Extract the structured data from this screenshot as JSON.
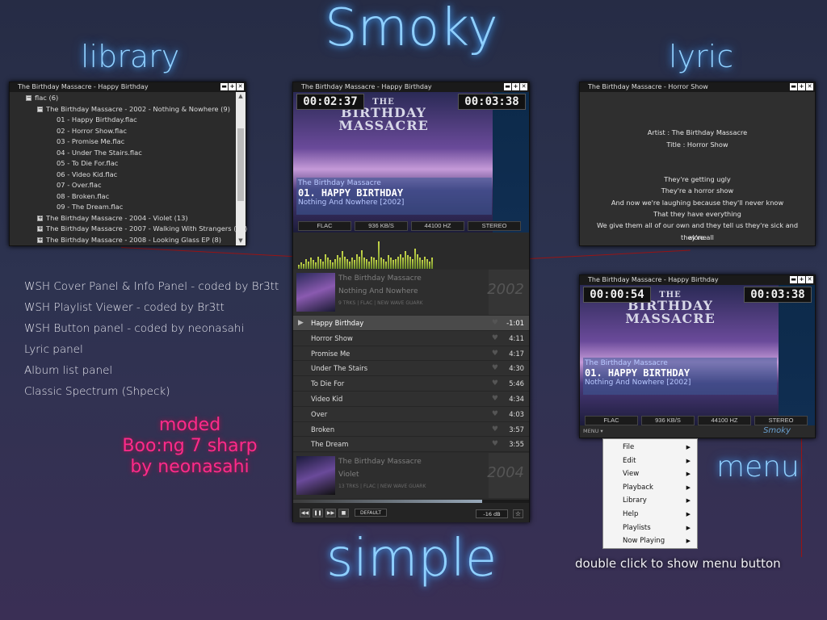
{
  "headings": {
    "title": "Smoky",
    "library": "library",
    "lyric": "lyric",
    "simple": "simple",
    "menu": "menu"
  },
  "library_window": {
    "title": "The Birthday Massacre - Happy Birthday",
    "rows": [
      {
        "text": "flac (6)",
        "level": 1,
        "expander": "−"
      },
      {
        "text": "The Birthday Massacre - 2002 - Nothing & Nowhere (9)",
        "level": 2,
        "expander": "−"
      },
      {
        "text": "01 - Happy Birthday.flac",
        "level": 3
      },
      {
        "text": "02 - Horror Show.flac",
        "level": 3
      },
      {
        "text": "03 - Promise Me.flac",
        "level": 3
      },
      {
        "text": "04 - Under The Stairs.flac",
        "level": 3
      },
      {
        "text": "05 - To Die For.flac",
        "level": 3
      },
      {
        "text": "06 - Video Kid.flac",
        "level": 3
      },
      {
        "text": "07 - Over.flac",
        "level": 3
      },
      {
        "text": "08 - Broken.flac",
        "level": 3
      },
      {
        "text": "09 - The Dream.flac",
        "level": 3
      },
      {
        "text": "The Birthday Massacre - 2004 - Violet (13)",
        "level": 2,
        "expander": "+"
      },
      {
        "text": "The Birthday Massacre - 2007 - Walking With Strangers (12)",
        "level": 2,
        "expander": "+"
      },
      {
        "text": "The Birthday Massacre - 2008 - Looking Glass EP (8)",
        "level": 2,
        "expander": "+"
      }
    ]
  },
  "lyric_window": {
    "title": "The Birthday Massacre - Horror Show",
    "lines": [
      "",
      "",
      "",
      "Artist : The Birthday Massacre",
      "Title : Horror Show",
      "",
      "",
      "They're getting ugly",
      "They're a horror show",
      "And now we're laughing because they'll never know",
      "That they have everything",
      "We give them all of our own and they tell us they're sick and they're all",
      "alone"
    ]
  },
  "main_player": {
    "title": "The Birthday Massacre - Happy Birthday",
    "elapsed": "00:02:37",
    "total": "00:03:38",
    "art_text": [
      "THE",
      "BIRTHDAY",
      "MASSACRE"
    ],
    "artist": "The Birthday Massacre",
    "track": "01. HAPPY BIRTHDAY",
    "album_line": "Nothing And Nowhere [2002]",
    "tech": [
      "FLAC",
      "936 KB/S",
      "44100 HZ",
      "STEREO"
    ],
    "spectrum": [
      3,
      5,
      4,
      8,
      6,
      9,
      7,
      5,
      10,
      8,
      6,
      12,
      9,
      7,
      5,
      8,
      11,
      9,
      14,
      10,
      8,
      6,
      9,
      7,
      12,
      10,
      15,
      9,
      8,
      6,
      10,
      9,
      7,
      22,
      9,
      8,
      6,
      11,
      9,
      7,
      8,
      10,
      12,
      9,
      14,
      11,
      10,
      8,
      16,
      12,
      9,
      7,
      10,
      8,
      6,
      9
    ],
    "album1": {
      "artist": "The Birthday Massacre",
      "album": "Nothing And Nowhere",
      "info": "9 TRKS | FLAC | NEW WAVE GUARK",
      "year": "2002"
    },
    "tracks": [
      {
        "name": "Happy Birthday",
        "dur": "-1:01",
        "current": true
      },
      {
        "name": "Horror Show",
        "dur": "4:11"
      },
      {
        "name": "Promise Me",
        "dur": "4:17"
      },
      {
        "name": "Under The Stairs",
        "dur": "4:30"
      },
      {
        "name": "To Die For",
        "dur": "5:46"
      },
      {
        "name": "Video Kid",
        "dur": "4:34"
      },
      {
        "name": "Over",
        "dur": "4:03"
      },
      {
        "name": "Broken",
        "dur": "3:57"
      },
      {
        "name": "The Dream",
        "dur": "3:55"
      }
    ],
    "album2": {
      "artist": "The Birthday Massacre",
      "album": "Violet",
      "info": "13 TRKS | FLAC | NEW WAVE GUARK",
      "year": "2004"
    },
    "buttons": {
      "prev": "◀◀",
      "pause": "❚❚",
      "next": "▶▶",
      "stop": "■",
      "dsp": "DEFAULT",
      "volume": "-16 dB",
      "star": "☆"
    }
  },
  "menu_player": {
    "title": "The Birthday Massacre - Happy Birthday",
    "elapsed": "00:00:54",
    "total": "00:03:38",
    "art_text": [
      "THE",
      "BIRTHDAY",
      "MASSACRE"
    ],
    "artist": "The Birthday Massacre",
    "track": "01. HAPPY BIRTHDAY",
    "album_line": "Nothing And Nowhere [2002]",
    "tech": [
      "FLAC",
      "936 KB/S",
      "44100 HZ",
      "STEREO"
    ],
    "menu_btn": "MENU ▾",
    "logo": "Smoky"
  },
  "context_menu": {
    "items": [
      "File",
      "Edit",
      "View",
      "Playback",
      "Library",
      "Help",
      "Playlists",
      "Now Playing"
    ],
    "arrow": "▶"
  },
  "credits": [
    "WSH Cover Panel & Info Panel - coded by Br3tt",
    "WSH Playlist Viewer - coded by Br3tt",
    "WSH Button panel - coded by neonasahi",
    "Lyric panel",
    "Album list panel",
    "Classic Spectrum (Shpeck)"
  ],
  "moded": [
    "moded",
    "Boo:ng 7 sharp",
    "by neonasahi"
  ],
  "hint": "double click to show menu button",
  "window_controls": [
    "▬",
    "+",
    "✕"
  ],
  "colors": {
    "accent": "#8fd0ff",
    "moded": "#ff2a8a",
    "line": "#9a1414"
  }
}
